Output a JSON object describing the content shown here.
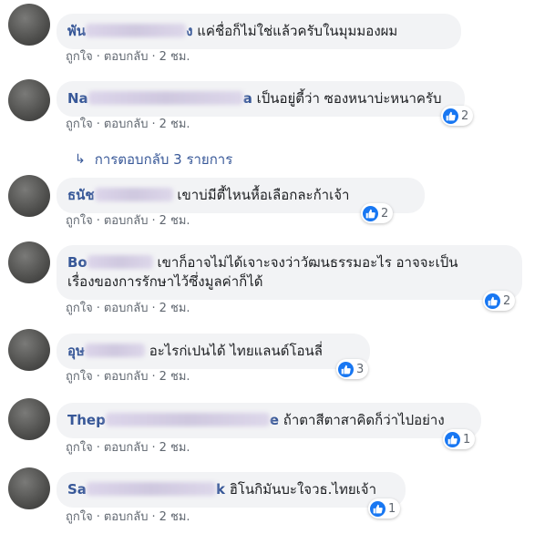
{
  "comments": [
    {
      "name": "พัน",
      "name_tail": "ง",
      "text": "แค่ชื่อก็ไม่ใช่แล้วครับในมุมมองผม",
      "like": "ถูกใจ",
      "reply": "ตอบกลับ",
      "time": "2 ชม.",
      "reactions": ""
    },
    {
      "name": "Na",
      "name_tail": "a",
      "text": "เป็นอยู่ตี้ว่า ซองหนาบ่ะหนาครับ",
      "like": "ถูกใจ",
      "reply": "ตอบกลับ",
      "time": "2 ชม.",
      "reactions": "2"
    },
    {
      "name": "ธนัช",
      "name_tail": "",
      "text": "เขาบ่มีตี้ไหนหื้อเลือกละก้าเจ้า",
      "like": "ถูกใจ",
      "reply": "ตอบกลับ",
      "time": "2 ชม.",
      "reactions": "2"
    },
    {
      "name": "Bo",
      "name_tail": "",
      "text": "เขาก็อาจไม่ได้เจาะจงว่าวัฒนธรรมอะไร อาจจะเป็น",
      "text2": "เรื่องของการรักษาไว้ซึ่งมูลค่าก็ได้",
      "like": "ถูกใจ",
      "reply": "ตอบกลับ",
      "time": "2 ชม.",
      "reactions": "2"
    },
    {
      "name": "อุษ",
      "name_tail": "",
      "text": "อะไรก่เปนได้ ไทยแลนด์โอนลี่",
      "like": "ถูกใจ",
      "reply": "ตอบกลับ",
      "time": "2 ชม.",
      "reactions": "3"
    },
    {
      "name": "Thep",
      "name_tail": "e",
      "text": "ถ้าตาสีตาสาคิดก็ว่าไปอย่าง",
      "like": "ถูกใจ",
      "reply": "ตอบกลับ",
      "time": "2 ชม.",
      "reactions": "1"
    },
    {
      "name": "Sa",
      "name_tail": "k",
      "text": "ฮิโนกิมันบะใจวธ.ไทยเจ้า",
      "like": "ถูกใจ",
      "reply": "ตอบกลับ",
      "time": "2 ชม.",
      "reactions": "1"
    }
  ],
  "replies_link": "การตอบกลับ 3 รายการ",
  "separator": "·",
  "colors": {
    "name": "#385898",
    "bubble": "#f2f3f5",
    "like_badge": "#1877f2",
    "meta": "#606770"
  }
}
